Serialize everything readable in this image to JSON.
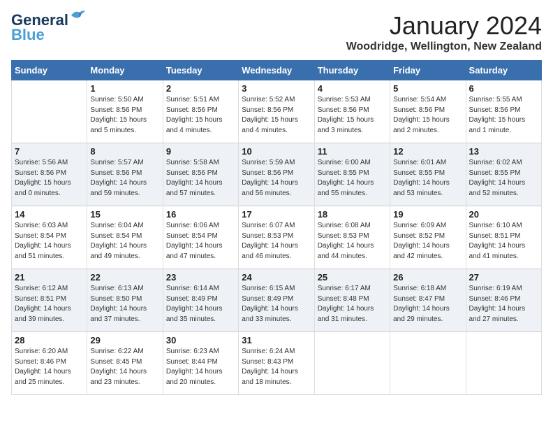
{
  "header": {
    "logo_line1": "General",
    "logo_line2": "Blue",
    "month": "January 2024",
    "location": "Woodridge, Wellington, New Zealand"
  },
  "days_of_week": [
    "Sunday",
    "Monday",
    "Tuesday",
    "Wednesday",
    "Thursday",
    "Friday",
    "Saturday"
  ],
  "weeks": [
    [
      {
        "day": "",
        "sunrise": "",
        "sunset": "",
        "daylight": ""
      },
      {
        "day": "1",
        "sunrise": "5:50 AM",
        "sunset": "8:56 PM",
        "daylight": "15 hours and 5 minutes."
      },
      {
        "day": "2",
        "sunrise": "5:51 AM",
        "sunset": "8:56 PM",
        "daylight": "15 hours and 4 minutes."
      },
      {
        "day": "3",
        "sunrise": "5:52 AM",
        "sunset": "8:56 PM",
        "daylight": "15 hours and 4 minutes."
      },
      {
        "day": "4",
        "sunrise": "5:53 AM",
        "sunset": "8:56 PM",
        "daylight": "15 hours and 3 minutes."
      },
      {
        "day": "5",
        "sunrise": "5:54 AM",
        "sunset": "8:56 PM",
        "daylight": "15 hours and 2 minutes."
      },
      {
        "day": "6",
        "sunrise": "5:55 AM",
        "sunset": "8:56 PM",
        "daylight": "15 hours and 1 minute."
      }
    ],
    [
      {
        "day": "7",
        "sunrise": "5:56 AM",
        "sunset": "8:56 PM",
        "daylight": "15 hours and 0 minutes."
      },
      {
        "day": "8",
        "sunrise": "5:57 AM",
        "sunset": "8:56 PM",
        "daylight": "14 hours and 59 minutes."
      },
      {
        "day": "9",
        "sunrise": "5:58 AM",
        "sunset": "8:56 PM",
        "daylight": "14 hours and 57 minutes."
      },
      {
        "day": "10",
        "sunrise": "5:59 AM",
        "sunset": "8:56 PM",
        "daylight": "14 hours and 56 minutes."
      },
      {
        "day": "11",
        "sunrise": "6:00 AM",
        "sunset": "8:55 PM",
        "daylight": "14 hours and 55 minutes."
      },
      {
        "day": "12",
        "sunrise": "6:01 AM",
        "sunset": "8:55 PM",
        "daylight": "14 hours and 53 minutes."
      },
      {
        "day": "13",
        "sunrise": "6:02 AM",
        "sunset": "8:55 PM",
        "daylight": "14 hours and 52 minutes."
      }
    ],
    [
      {
        "day": "14",
        "sunrise": "6:03 AM",
        "sunset": "8:54 PM",
        "daylight": "14 hours and 51 minutes."
      },
      {
        "day": "15",
        "sunrise": "6:04 AM",
        "sunset": "8:54 PM",
        "daylight": "14 hours and 49 minutes."
      },
      {
        "day": "16",
        "sunrise": "6:06 AM",
        "sunset": "8:54 PM",
        "daylight": "14 hours and 47 minutes."
      },
      {
        "day": "17",
        "sunrise": "6:07 AM",
        "sunset": "8:53 PM",
        "daylight": "14 hours and 46 minutes."
      },
      {
        "day": "18",
        "sunrise": "6:08 AM",
        "sunset": "8:53 PM",
        "daylight": "14 hours and 44 minutes."
      },
      {
        "day": "19",
        "sunrise": "6:09 AM",
        "sunset": "8:52 PM",
        "daylight": "14 hours and 42 minutes."
      },
      {
        "day": "20",
        "sunrise": "6:10 AM",
        "sunset": "8:51 PM",
        "daylight": "14 hours and 41 minutes."
      }
    ],
    [
      {
        "day": "21",
        "sunrise": "6:12 AM",
        "sunset": "8:51 PM",
        "daylight": "14 hours and 39 minutes."
      },
      {
        "day": "22",
        "sunrise": "6:13 AM",
        "sunset": "8:50 PM",
        "daylight": "14 hours and 37 minutes."
      },
      {
        "day": "23",
        "sunrise": "6:14 AM",
        "sunset": "8:49 PM",
        "daylight": "14 hours and 35 minutes."
      },
      {
        "day": "24",
        "sunrise": "6:15 AM",
        "sunset": "8:49 PM",
        "daylight": "14 hours and 33 minutes."
      },
      {
        "day": "25",
        "sunrise": "6:17 AM",
        "sunset": "8:48 PM",
        "daylight": "14 hours and 31 minutes."
      },
      {
        "day": "26",
        "sunrise": "6:18 AM",
        "sunset": "8:47 PM",
        "daylight": "14 hours and 29 minutes."
      },
      {
        "day": "27",
        "sunrise": "6:19 AM",
        "sunset": "8:46 PM",
        "daylight": "14 hours and 27 minutes."
      }
    ],
    [
      {
        "day": "28",
        "sunrise": "6:20 AM",
        "sunset": "8:46 PM",
        "daylight": "14 hours and 25 minutes."
      },
      {
        "day": "29",
        "sunrise": "6:22 AM",
        "sunset": "8:45 PM",
        "daylight": "14 hours and 23 minutes."
      },
      {
        "day": "30",
        "sunrise": "6:23 AM",
        "sunset": "8:44 PM",
        "daylight": "14 hours and 20 minutes."
      },
      {
        "day": "31",
        "sunrise": "6:24 AM",
        "sunset": "8:43 PM",
        "daylight": "14 hours and 18 minutes."
      },
      {
        "day": "",
        "sunrise": "",
        "sunset": "",
        "daylight": ""
      },
      {
        "day": "",
        "sunrise": "",
        "sunset": "",
        "daylight": ""
      },
      {
        "day": "",
        "sunrise": "",
        "sunset": "",
        "daylight": ""
      }
    ]
  ]
}
